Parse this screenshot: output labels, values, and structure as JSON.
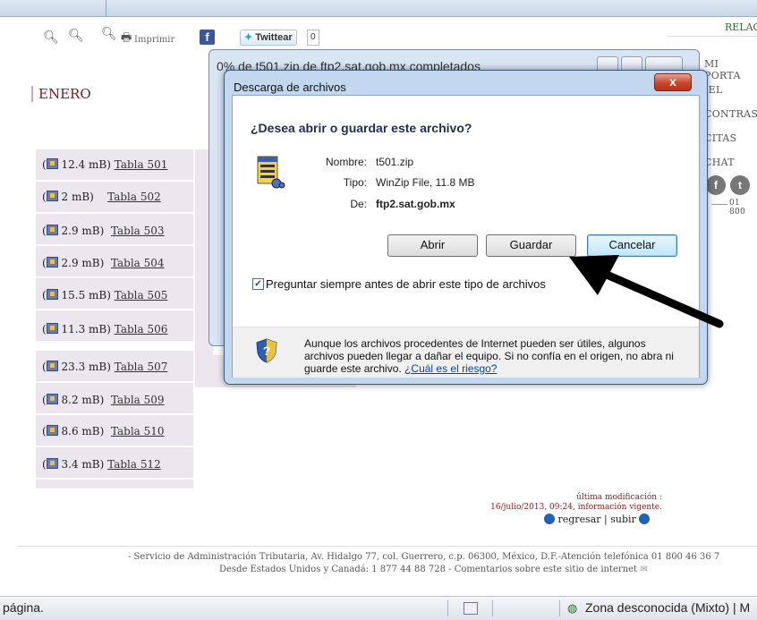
{
  "toolbar": {
    "print_label": "Imprimir",
    "twitter_label": "Twittear",
    "twitter_count": "0"
  },
  "month": "ENERO",
  "rel": {
    "title": "RELAC",
    "items": [
      "MI PORTA",
      "IEL",
      "CONTRAS",
      "CITAS",
      "CHAT"
    ],
    "social": [
      "f",
      "t"
    ],
    "phone": "01 800"
  },
  "rows": [
    {
      "size": "12.4 mB",
      "table": "Tabla 501"
    },
    {
      "size": "2 mB",
      "table": "Tabla 502"
    },
    {
      "size": "2.9 mB",
      "table": "Tabla 503"
    },
    {
      "size": "2.9 mB",
      "table": "Tabla 504"
    },
    {
      "size": "15.5 mB",
      "table": "Tabla 505"
    },
    {
      "size": "11.3 mB",
      "table": "Tabla 506"
    },
    {
      "size": "23.3 mB",
      "table": "Tabla 507"
    },
    {
      "size": "8.2 mB",
      "table": "Tabla 509"
    },
    {
      "size": "8.6 mB",
      "table": "Tabla 510"
    },
    {
      "size": "3.4 mB",
      "table": "Tabla 512"
    }
  ],
  "last_mod": {
    "label": "última modificación :",
    "value": "16/julio/2013, 09:24, información vigente."
  },
  "nav": {
    "back": "regresar",
    "sep": "|",
    "up": "subir"
  },
  "footer": {
    "line1": "- Servicio de Administración Tributaria, Av. Hidalgo 77, col. Guerrero, c.p. 06300, México, D.F.-Atención telefónica 01 800 46 36 7",
    "line2": "Desde Estados Unidos y Canadá: 1 877 44 88 728 - Comentarios sobre este sitio de internet"
  },
  "statusbar": {
    "left": "página.",
    "zone": "Zona desconocida (Mixto) | M"
  },
  "progress_dialog": {
    "title": "0% de t501.zip de ftp2.sat.gob.mx completados"
  },
  "dialog": {
    "title": "Descarga de archivos",
    "close": "x",
    "question": "¿Desea abrir o guardar este archivo?",
    "name_label": "Nombre:",
    "name_value": "t501.zip",
    "type_label": "Tipo:",
    "type_value": "WinZip File, 11.8 MB",
    "from_label": "De:",
    "from_value": "ftp2.sat.gob.mx",
    "btn_open": "Abrir",
    "btn_save": "Guardar",
    "btn_cancel": "Cancelar",
    "checkbox_label": "Preguntar siempre antes de abrir este tipo de archivos",
    "checkbox_checked": true,
    "warning_text": "Aunque los archivos procedentes de Internet pueden ser útiles, algunos archivos pueden llegar a dañar el equipo. Si no confía en el origen, no abra ni guarde este archivo.",
    "risk_link": "¿Cuál es el riesgo?"
  }
}
